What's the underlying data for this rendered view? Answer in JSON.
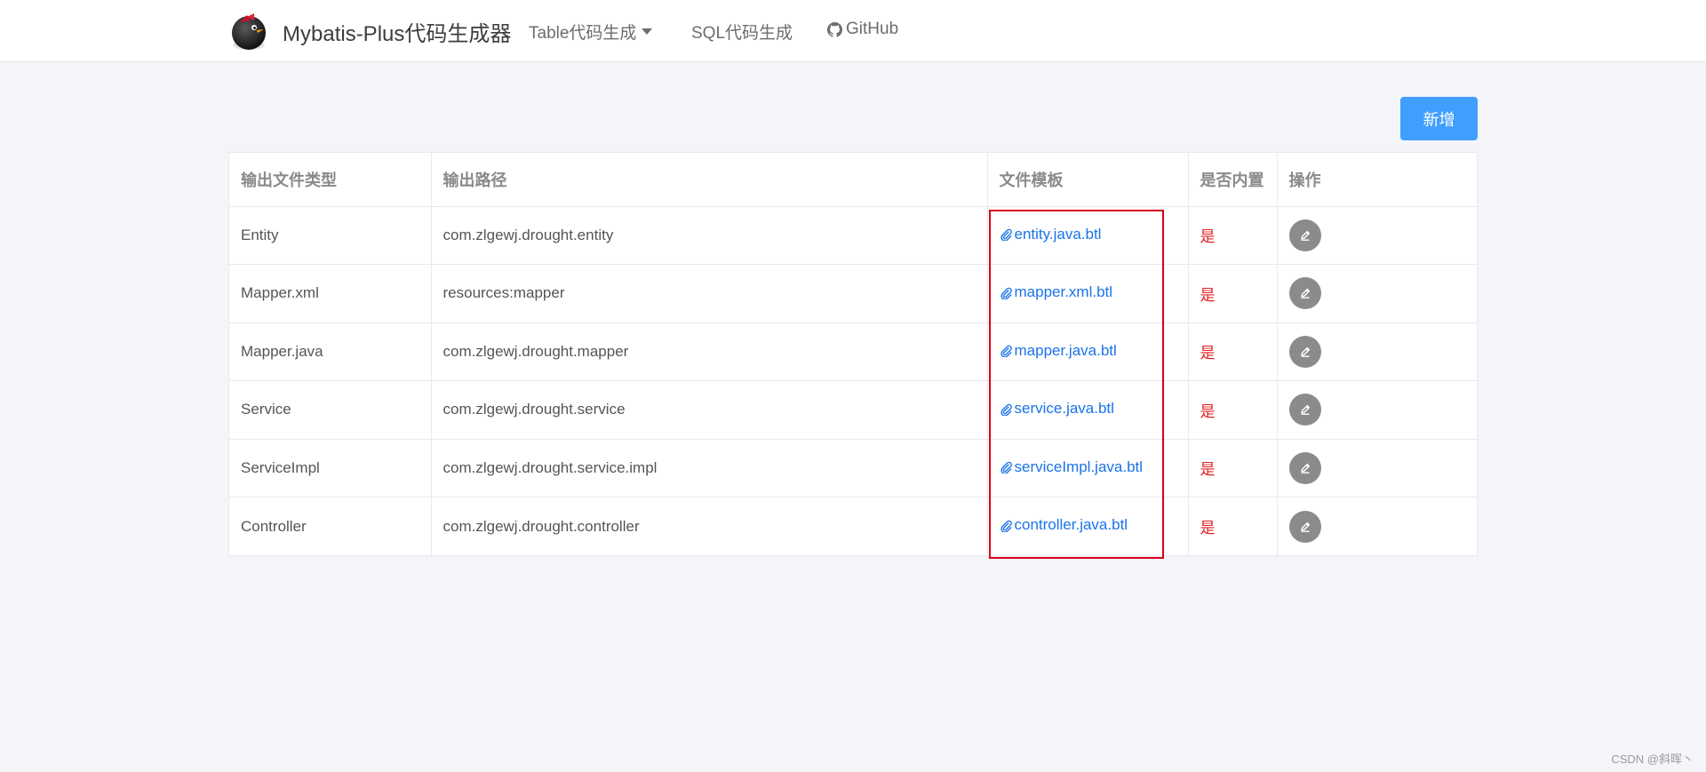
{
  "navbar": {
    "brand_title": "Mybatis-Plus代码生成器",
    "items": [
      {
        "label": "Table代码生成",
        "has_dropdown": true
      },
      {
        "label": "SQL代码生成"
      },
      {
        "label": "GitHub",
        "icon": "github-icon"
      }
    ]
  },
  "toolbar": {
    "add_label": "新增"
  },
  "table": {
    "headers": [
      "输出文件类型",
      "输出路径",
      "文件模板",
      "是否内置",
      "操作"
    ],
    "rows": [
      {
        "type": "Entity",
        "path": "com.zlgewj.drought.entity",
        "template": "entity.java.btl",
        "builtin": "是"
      },
      {
        "type": "Mapper.xml",
        "path": "resources:mapper",
        "template": "mapper.xml.btl",
        "builtin": "是"
      },
      {
        "type": "Mapper.java",
        "path": "com.zlgewj.drought.mapper",
        "template": "mapper.java.btl",
        "builtin": "是"
      },
      {
        "type": "Service",
        "path": "com.zlgewj.drought.service",
        "template": "service.java.btl",
        "builtin": "是"
      },
      {
        "type": "ServiceImpl",
        "path": "com.zlgewj.drought.service.impl",
        "template": "serviceImpl.java.btl",
        "builtin": "是"
      },
      {
        "type": "Controller",
        "path": "com.zlgewj.drought.controller",
        "template": "controller.java.btl",
        "builtin": "是"
      }
    ]
  },
  "watermark": "CSDN @斜晖丶",
  "colors": {
    "accent": "#409eff",
    "link": "#1a73e8",
    "builtin": "#e02020",
    "highlight": "#d9001b"
  }
}
